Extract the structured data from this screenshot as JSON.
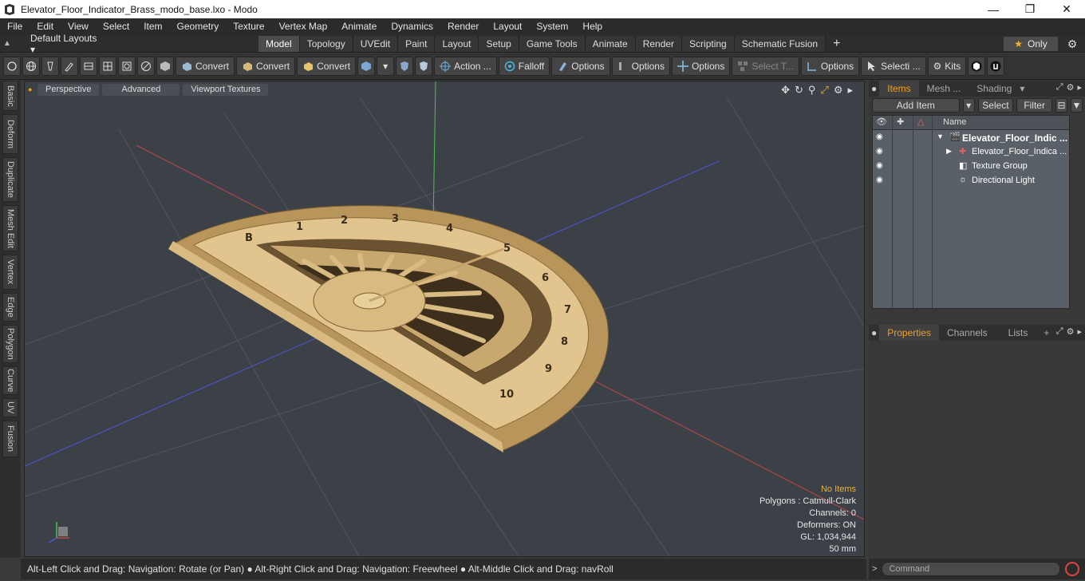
{
  "window": {
    "title": "Elevator_Floor_Indicator_Brass_modo_base.lxo - Modo"
  },
  "menu": [
    "File",
    "Edit",
    "View",
    "Select",
    "Item",
    "Geometry",
    "Texture",
    "Vertex Map",
    "Animate",
    "Dynamics",
    "Render",
    "Layout",
    "System",
    "Help"
  ],
  "layout": {
    "default_label": "Default Layouts",
    "tabs": [
      "Model",
      "Topology",
      "UVEdit",
      "Paint",
      "Layout",
      "Setup",
      "Game Tools",
      "Animate",
      "Render",
      "Scripting",
      "Schematic Fusion"
    ],
    "active_tab": "Model",
    "only_label": "Only"
  },
  "toolbar": {
    "convert1": "Convert",
    "convert2": "Convert",
    "convert3": "Convert",
    "action": "Action ...",
    "falloff": "Falloff",
    "options1": "Options",
    "options2": "Options",
    "options3": "Options",
    "options4": "Options",
    "select_t": "Select T...",
    "selecti": "Selecti ...",
    "kits": "Kits"
  },
  "left_tabs": [
    "Basic",
    "Deform",
    "Duplicate",
    "Mesh Edit",
    "Vertex",
    "Edge",
    "Polygon",
    "Curve",
    "UV",
    "Fusion"
  ],
  "viewport": {
    "perspective": "Perspective",
    "advanced": "Advanced",
    "textures": "Viewport Textures",
    "info": {
      "no_items": "No Items",
      "polygons": "Polygons : Catmull-Clark",
      "channels": "Channels: 0",
      "deformers": "Deformers: ON",
      "gl": "GL: 1,034,944",
      "focal": "50 mm"
    }
  },
  "status": "Alt-Left Click and Drag: Navigation: Rotate (or Pan) ● Alt-Right Click and Drag: Navigation: Freewheel ● Alt-Middle Click and Drag: navRoll",
  "items_panel": {
    "tabs": [
      "Items",
      "Mesh ...",
      "Shading"
    ],
    "add_item": "Add Item",
    "select": "Select",
    "filter": "Filter",
    "name_col": "Name",
    "rows": [
      {
        "label": "Elevator_Floor_Indic ...",
        "bold": true
      },
      {
        "label": "Elevator_Floor_Indica ...",
        "bold": false
      },
      {
        "label": "Texture Group",
        "bold": false
      },
      {
        "label": "Directional Light",
        "bold": false
      }
    ]
  },
  "properties_panel": {
    "tabs": [
      "Properties",
      "Channels",
      "Lists"
    ]
  },
  "command": {
    "placeholder": "Command"
  }
}
